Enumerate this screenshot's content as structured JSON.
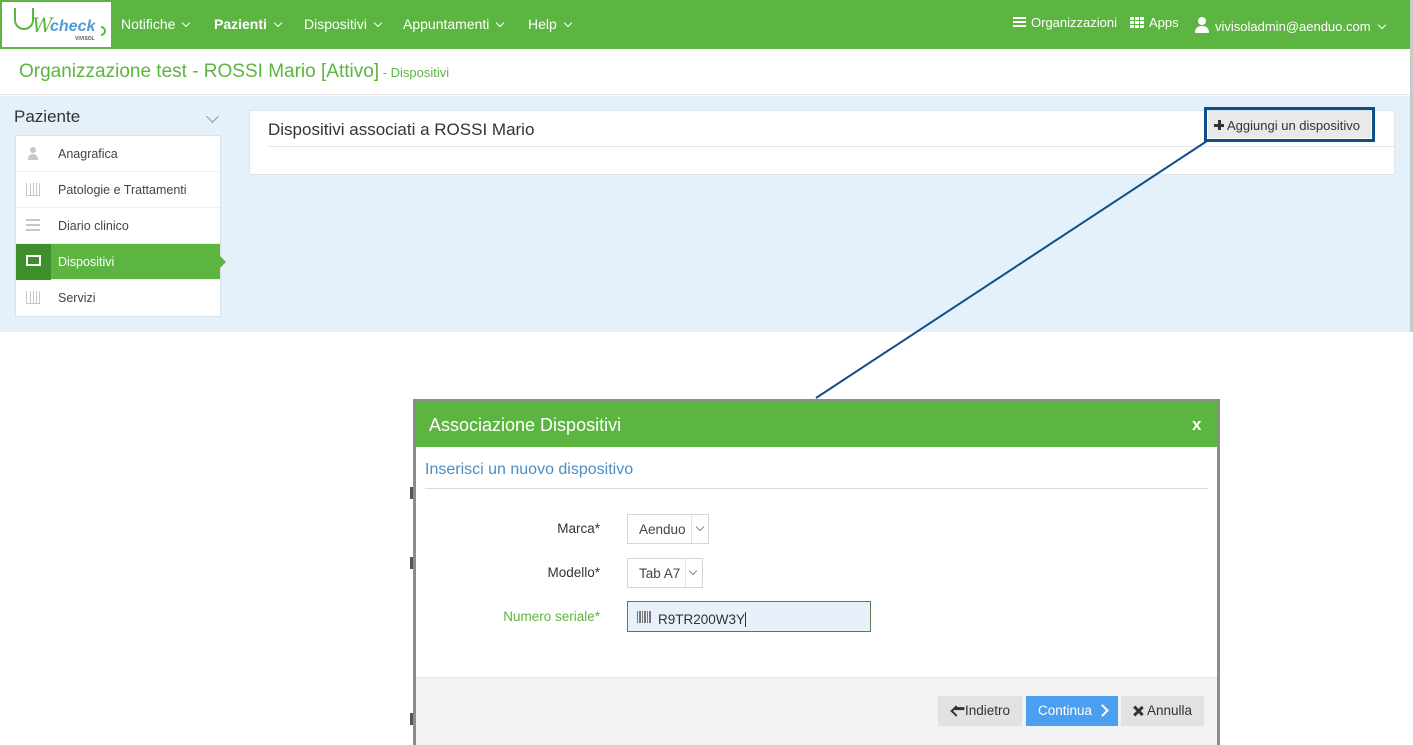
{
  "app": {
    "logo_w": "W",
    "logo_check": "check",
    "logo_sub": "VIVISOL"
  },
  "nav": {
    "items": [
      {
        "label": "Notifiche"
      },
      {
        "label": "Pazienti"
      },
      {
        "label": "Dispositivi"
      },
      {
        "label": "Appuntamenti"
      },
      {
        "label": "Help"
      }
    ],
    "organizations": "Organizzazioni",
    "apps": "Apps",
    "user": "vivisoladmin@aenduo.com"
  },
  "breadcrumb": {
    "title": "Organizzazione test - ROSSI Mario [Attivo]",
    "sub": " - Dispositivi"
  },
  "sidebar": {
    "title": "Paziente",
    "items": [
      {
        "label": "Anagrafica",
        "icon": "user-icon"
      },
      {
        "label": "Patologie e Trattamenti",
        "icon": "bar-chart-icon"
      },
      {
        "label": "Diario clinico",
        "icon": "list-icon"
      },
      {
        "label": "Dispositivi",
        "icon": "monitor-icon",
        "active": true
      },
      {
        "label": "Servizi",
        "icon": "bar-chart-icon"
      }
    ]
  },
  "panel": {
    "title": "Dispositivi associati a ROSSI Mario",
    "add_button": "Aggiungi un dispositivo"
  },
  "modal": {
    "title": "Associazione Dispositivi",
    "close": "x",
    "subtitle": "Inserisci un nuovo dispositivo",
    "fields": {
      "brand_label": "Marca*",
      "brand_value": "Aenduo",
      "model_label": "Modello*",
      "model_value": "Tab A7",
      "serial_label": "Numero seriale*",
      "serial_value": "R9TR200W3Y"
    },
    "buttons": {
      "back": "Indietro",
      "next": "Continua",
      "cancel": "Annulla"
    }
  },
  "colors": {
    "brand_green": "#5cb540",
    "highlight_frame": "#0d4f8b",
    "primary_blue": "#4a9ff0",
    "content_bg": "#e4f0fa"
  }
}
